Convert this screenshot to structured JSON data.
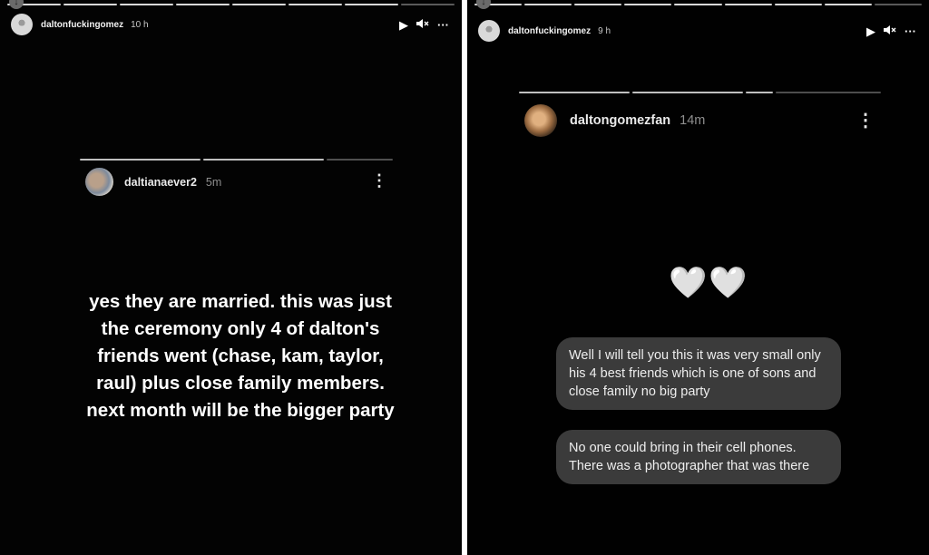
{
  "left_story": {
    "username": "daltonfuckingomez",
    "time": "10 h",
    "controls": {
      "play_icon": "▶",
      "mute_icon": "🔇",
      "more_icon": "···"
    },
    "reply": {
      "username": "daltianaever2",
      "time": "5m",
      "menu_icon": "⋮",
      "text": "yes they are married. this was just the ceremony only 4 of dalton's friends went (chase, kam, taylor, raul) plus close family members. next month will be the bigger party"
    }
  },
  "right_story": {
    "username": "daltonfuckingomez",
    "time": "9 h",
    "controls": {
      "play_icon": "▶",
      "mute_icon": "🔇",
      "more_icon": "···"
    },
    "reply": {
      "username": "daltongomezfan",
      "time": "14m",
      "menu_icon": "⋮",
      "emoji": "🤍🤍",
      "messages": [
        "Well I will tell you this it was very small only his 4 best friends which is one of sons and close family no big party",
        "No one could bring in their cell phones. There was a photographer that was there"
      ]
    }
  }
}
